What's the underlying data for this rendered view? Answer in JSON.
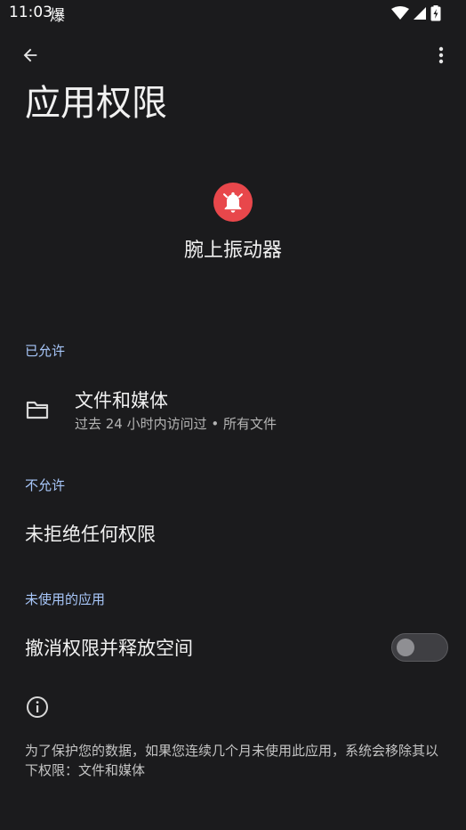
{
  "status_bar": {
    "time": "11:03",
    "app_indicator_glyph": "爆"
  },
  "header": {
    "title": "应用权限"
  },
  "app": {
    "name": "腕上振动器",
    "icon": "bell-alert-icon",
    "icon_color": "#e8474b"
  },
  "sections": {
    "allowed": {
      "header": "已允许",
      "items": [
        {
          "title": "文件和媒体",
          "summary": "过去 24 小时内访问过 • 所有文件",
          "icon": "folder-icon"
        }
      ]
    },
    "denied": {
      "header": "不允许",
      "empty_text": "未拒绝任何权限"
    },
    "unused_apps": {
      "header": "未使用的应用",
      "toggle_label": "撤消权限并释放空间",
      "toggle_on": false
    }
  },
  "footer": {
    "info_icon": "info-icon",
    "text": "为了保护您的数据，如果您连续几个月未使用此应用，系统会移除其以下权限：文件和媒体"
  },
  "colors": {
    "background": "#1b1b1d",
    "accent": "#a8c7fa"
  }
}
